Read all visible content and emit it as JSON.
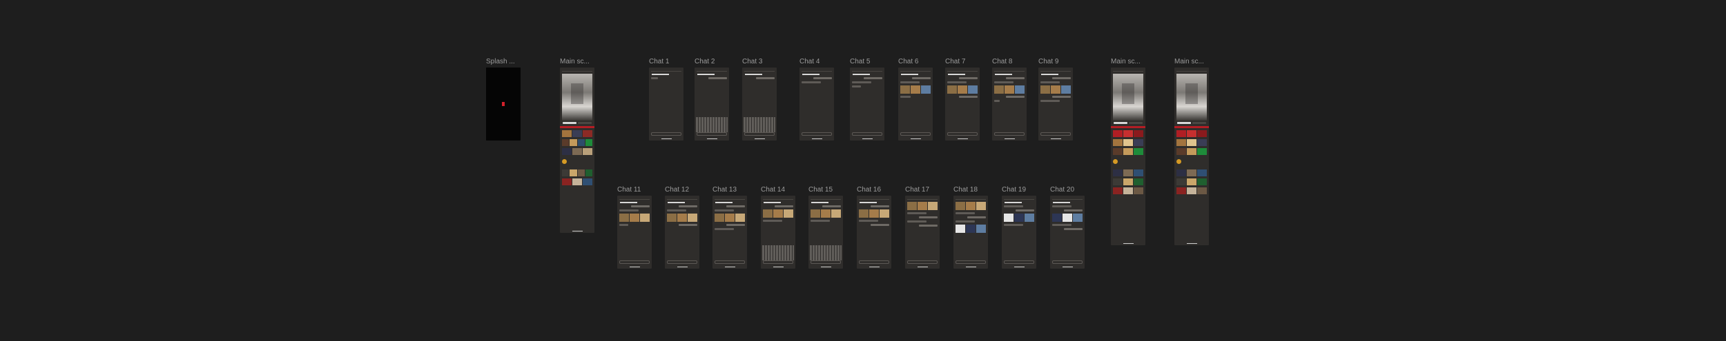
{
  "canvas": {
    "background": "#1e1e1e",
    "label_color": "#9b9b9b"
  },
  "frames": {
    "splash": {
      "label": "Splash ..."
    },
    "main1": {
      "label": "Main sc..."
    },
    "main2": {
      "label": "Main sc..."
    },
    "main3": {
      "label": "Main sc..."
    },
    "chat1": {
      "label": "Chat 1"
    },
    "chat2": {
      "label": "Chat 2"
    },
    "chat3": {
      "label": "Chat 3"
    },
    "chat4": {
      "label": "Chat 4"
    },
    "chat5": {
      "label": "Chat 5"
    },
    "chat6": {
      "label": "Chat 6"
    },
    "chat7": {
      "label": "Chat 7"
    },
    "chat8": {
      "label": "Chat 8"
    },
    "chat9": {
      "label": "Chat 9"
    },
    "chat11": {
      "label": "Chat 11"
    },
    "chat12": {
      "label": "Chat 12"
    },
    "chat13": {
      "label": "Chat 13"
    },
    "chat14": {
      "label": "Chat 14"
    },
    "chat15": {
      "label": "Chat 15"
    },
    "chat16": {
      "label": "Chat 16"
    },
    "chat17": {
      "label": "Chat 17"
    },
    "chat18": {
      "label": "Chat 18"
    },
    "chat19": {
      "label": "Chat 19"
    },
    "chat20": {
      "label": "Chat 20"
    }
  },
  "colors": {
    "splash_logo": "#d3212b",
    "phone_bg": "#2f2d2b",
    "accent_red": "#b31d24"
  }
}
